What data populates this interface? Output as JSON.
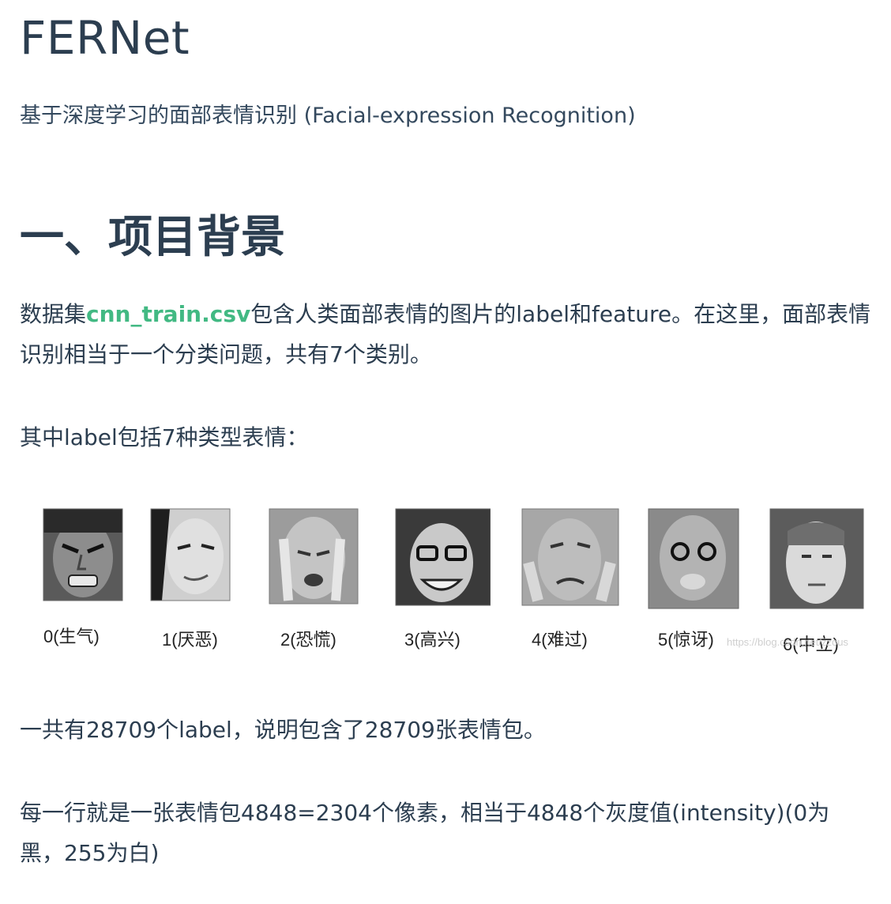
{
  "title": "FERNet",
  "subtitle": "基于深度学习的面部表情识别 (Facial-expression Recognition)",
  "section1": {
    "heading": "一、项目背景",
    "p1_prefix": "数据集",
    "p1_code": "cnn_train.csv",
    "p1_suffix": "包含人类面部表情的图片的label和feature。在这里，面部表情识别相当于一个分类问题，共有7个类别。",
    "p2": "其中label包括7种类型表情：",
    "p3": "一共有28709个label，说明包含了28709张表情包。",
    "p4": "每一行就是一张表情包4848=2304个像素，相当于4848个灰度值(intensity)(0为黑，255为白)"
  },
  "figure": {
    "captions": [
      "0(生气)",
      "1(厌恶)",
      "2(恐慌)",
      "3(高兴)",
      "4(难过)",
      "5(惊讶)",
      "6(中立)"
    ],
    "watermark": "https://blog.csdn.net/zzous"
  },
  "colors": {
    "text": "#2c3e50",
    "code_link": "#42b983"
  }
}
